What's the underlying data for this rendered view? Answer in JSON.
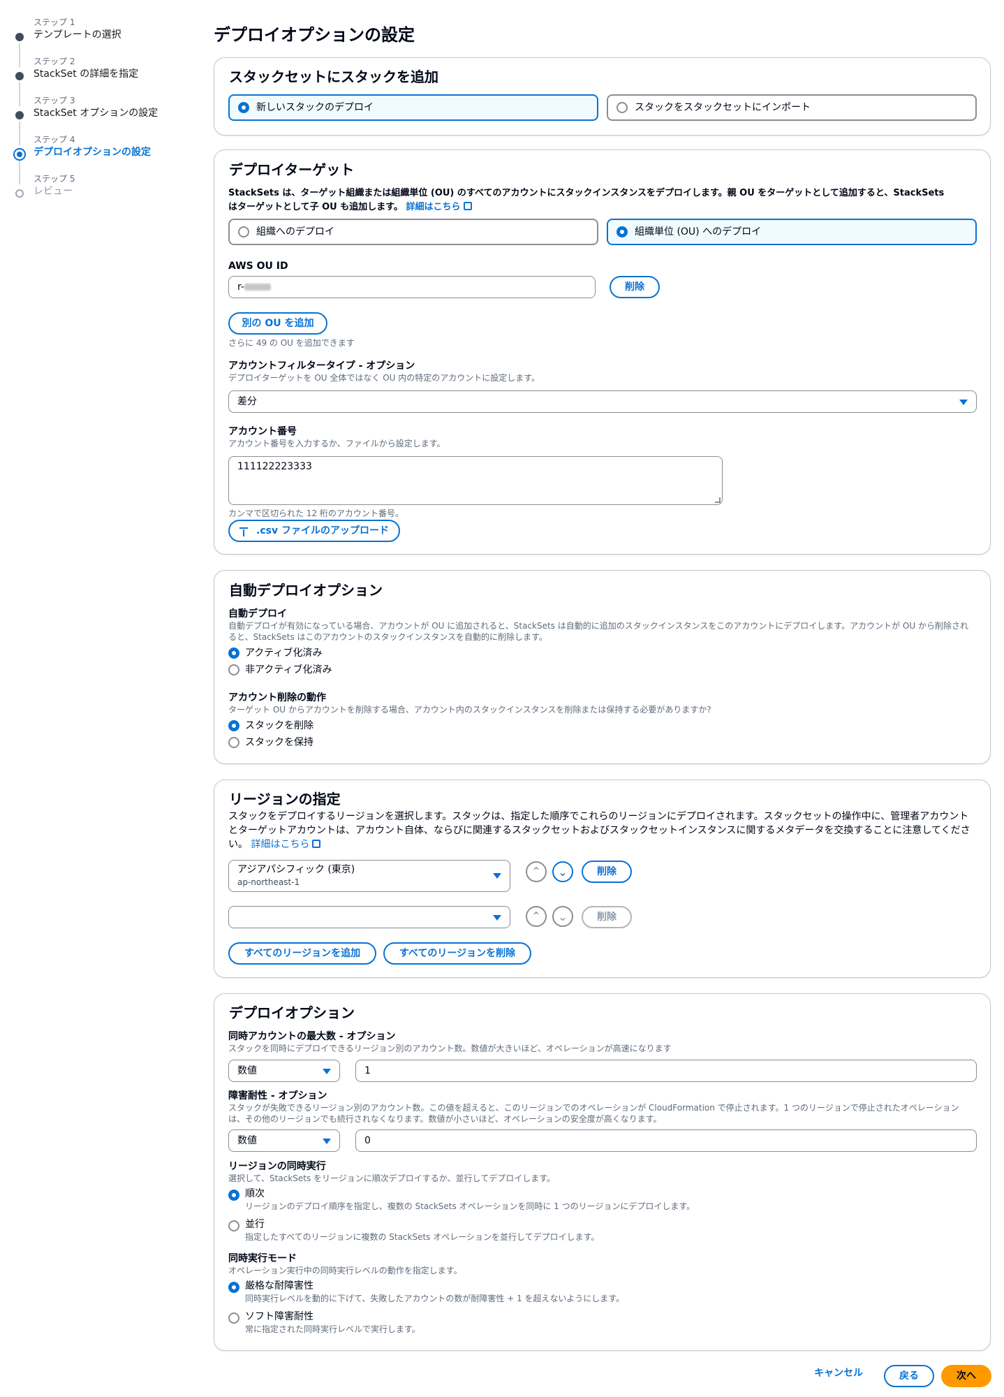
{
  "sidebar": {
    "steps": [
      {
        "num": "ステップ 1",
        "label": "テンプレートの選択"
      },
      {
        "num": "ステップ 2",
        "label": "StackSet の詳細を指定"
      },
      {
        "num": "ステップ 3",
        "label": "StackSet オプションの設定"
      },
      {
        "num": "ステップ 4",
        "label": "デプロイオプションの設定"
      },
      {
        "num": "ステップ 5",
        "label": "レビュー"
      }
    ]
  },
  "page_title": "デプロイオプションの設定",
  "add_stacks": {
    "title": "スタックセットにスタックを追加",
    "option_new": "新しいスタックのデプロイ",
    "option_import": "スタックをスタックセットにインポート"
  },
  "deploy_target": {
    "title": "デプロイターゲット",
    "desc_line1": "StackSets は、ターゲット組織または組織単位 (OU) のすべてのアカウントにスタックインスタンスをデプロイします。親 OU をターゲットとして追加すると、StackSets",
    "desc_line2": "はターゲットとして子 OU も追加します。",
    "learn_more": "詳細はこちら",
    "option_org": "組織へのデプロイ",
    "option_ou": "組織単位 (OU) へのデプロイ",
    "ou_id_label": "AWS OU ID",
    "ou_id_value_prefix": "r-",
    "remove_label": "削除",
    "add_ou_label": "別の OU を追加",
    "add_ou_hint": "さらに 49 の OU を追加できます",
    "filter_label": "アカウントフィルタータイプ - オプション",
    "filter_desc": "デプロイターゲットを OU 全体ではなく OU 内の特定のアカウントに設定します。",
    "filter_value": "差分",
    "account_label": "アカウント番号",
    "account_desc": "アカウント番号を入力するか、ファイルから設定します。",
    "account_value": "111122223333",
    "account_hint": "カンマで区切られた 12 桁のアカウント番号。",
    "upload_label": ".csv ファイルのアップロード"
  },
  "auto_deploy": {
    "title": "自動デプロイオプション",
    "auto_label": "自動デプロイ",
    "auto_desc_line1": "自動デプロイが有効になっている場合、アカウントが OU に追加されると、StackSets は自動的に追加のスタックインスタンスをこのアカウントにデプロイします。アカウントが OU から削除され",
    "auto_desc_line2": "ると、StackSets はこのアカウントのスタックインスタンスを自動的に削除します。",
    "auto_on": "アクティブ化済み",
    "auto_off": "非アクティブ化済み",
    "removal_label": "アカウント削除の動作",
    "removal_desc": "ターゲット OU からアカウントを削除する場合、アカウント内のスタックインスタンスを削除または保持する必要がありますか?",
    "removal_delete": "スタックを削除",
    "removal_retain": "スタックを保持"
  },
  "regions": {
    "title": "リージョンの指定",
    "desc_line1": "スタックをデプロイするリージョンを選択します。スタックは、指定した順序でこれらのリージョンにデプロイされます。スタックセットの操作中に、管理者アカウント",
    "desc_line2": "とターゲットアカウントは、アカウント自体、ならびに関連するスタックセットおよびスタックセットインスタンスに関するメタデータを交換することに注意してくださ",
    "desc_line3": "い。",
    "learn_more": "詳細はこちら",
    "region1_name": "アジアパシフィック (東京)",
    "region1_code": "ap-northeast-1",
    "remove_label": "削除",
    "add_all": "すべてのリージョンを追加",
    "remove_all": "すべてのリージョンを削除"
  },
  "deploy_options": {
    "title": "デプロイオプション",
    "max_label": "同時アカウントの最大数 - オプション",
    "max_desc": "スタックを同時にデプロイできるリージョン別のアカウント数。数値が大きいほど、オペレーションが高速になります",
    "max_type": "数値",
    "max_value": "1",
    "fault_label": "障害耐性 - オプション",
    "fault_desc_line1": "スタックが失敗できるリージョン別のアカウント数。この値を超えると、このリージョンでのオペレーションが CloudFormation で停止されます。1 つのリージョンで停止されたオペレーション",
    "fault_desc_line2": "は、その他のリージョンでも続行されなくなります。数値が小さいほど、オペレーションの安全度が高くなります。",
    "fault_type": "数値",
    "fault_value": "0",
    "region_conc_label": "リージョンの同時実行",
    "region_conc_desc": "選択して、StackSets をリージョンに順次デプロイするか、並行してデプロイします。",
    "seq_label": "順次",
    "seq_desc": "リージョンのデプロイ順序を指定し、複数の StackSets オペレーションを同時に 1 つのリージョンにデプロイします。",
    "par_label": "並行",
    "par_desc": "指定したすべてのリージョンに複数の StackSets オペレーションを並行してデプロイします。",
    "mode_label": "同時実行モード",
    "mode_desc": "オペレーション実行中の同時実行レベルの動作を指定します。",
    "strict_label": "厳格な耐障害性",
    "strict_desc": "同時実行レベルを動的に下げて、失敗したアカウントの数が耐障害性 + 1 を超えないようにします。",
    "soft_label": "ソフト障害耐性",
    "soft_desc": "常に指定された同時実行レベルで実行します。"
  },
  "footer": {
    "cancel": "キャンセル",
    "back": "戻る",
    "next": "次へ"
  },
  "colors": {
    "accent": "#0972d3",
    "primary_button": "#ff9900",
    "border": "#c6c6cd"
  }
}
